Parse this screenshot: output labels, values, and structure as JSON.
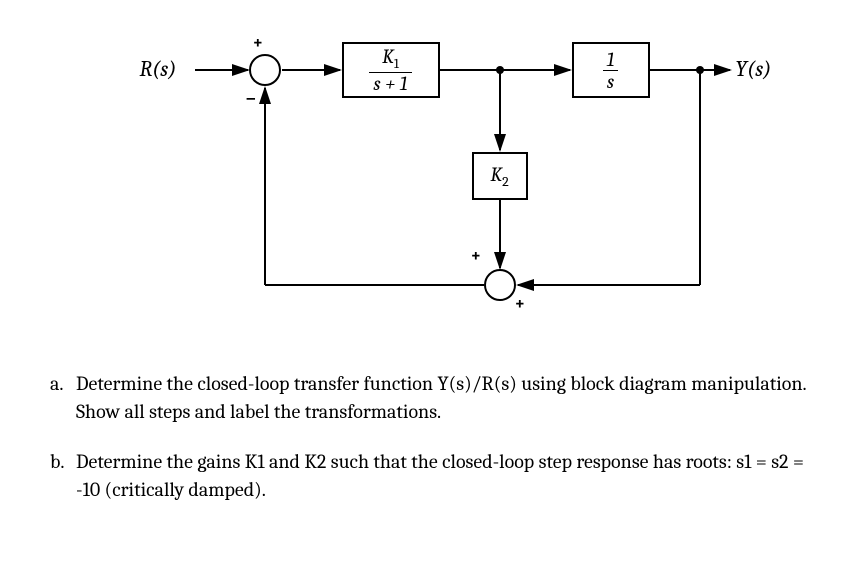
{
  "diagram": {
    "input_label": "R(s)",
    "output_label": "Y(s)",
    "block_g1_num": "K",
    "block_g1_num_sub": "1",
    "block_g1_den": "s + 1",
    "block_g2_num": "1",
    "block_g2_den": "s",
    "block_h_label": "K",
    "block_h_sub": "2",
    "sum1_top_sign": "+",
    "sum1_bottom_sign": "−",
    "sum2_top_sign": "+",
    "sum2_right_sign": "+"
  },
  "questions": {
    "a_letter": "a.",
    "a_text": "Determine the closed-loop transfer function Y(s)/R(s) using block diagram manipulation.  Show all steps and label the transformations.",
    "b_letter": "b.",
    "b_text": "Determine the gains K1 and K2 such that the closed-loop step response has roots: s1 = s2 = -10 (critically damped)."
  },
  "chart_data": {
    "type": "block_diagram",
    "input": "R(s)",
    "output": "Y(s)",
    "summing_junctions": [
      {
        "id": "S1",
        "inputs": [
          {
            "from": "R(s)",
            "sign": "+"
          },
          {
            "from": "S2_output",
            "sign": "-"
          }
        ],
        "output_to": "G1"
      },
      {
        "id": "S2",
        "inputs": [
          {
            "from": "K2_output",
            "sign": "+"
          },
          {
            "from": "Y(s)",
            "sign": "+"
          }
        ],
        "output_to": "S1_negative"
      }
    ],
    "blocks": [
      {
        "id": "G1",
        "tf": "K1 / (s + 1)",
        "input_from": "S1",
        "output_to": [
          "G2",
          "K2_via_pickoff"
        ]
      },
      {
        "id": "G2",
        "tf": "1 / s",
        "input_from": "G1",
        "output_to": "Y(s)"
      },
      {
        "id": "H1",
        "tf": "K2",
        "input_from": "pickoff_between_G1_G2",
        "output_to": "S2"
      }
    ],
    "feedback_paths": [
      {
        "from": "Y(s)",
        "to": "S2",
        "sign": "+"
      },
      {
        "from": "S2",
        "to": "S1",
        "sign": "-"
      }
    ]
  }
}
